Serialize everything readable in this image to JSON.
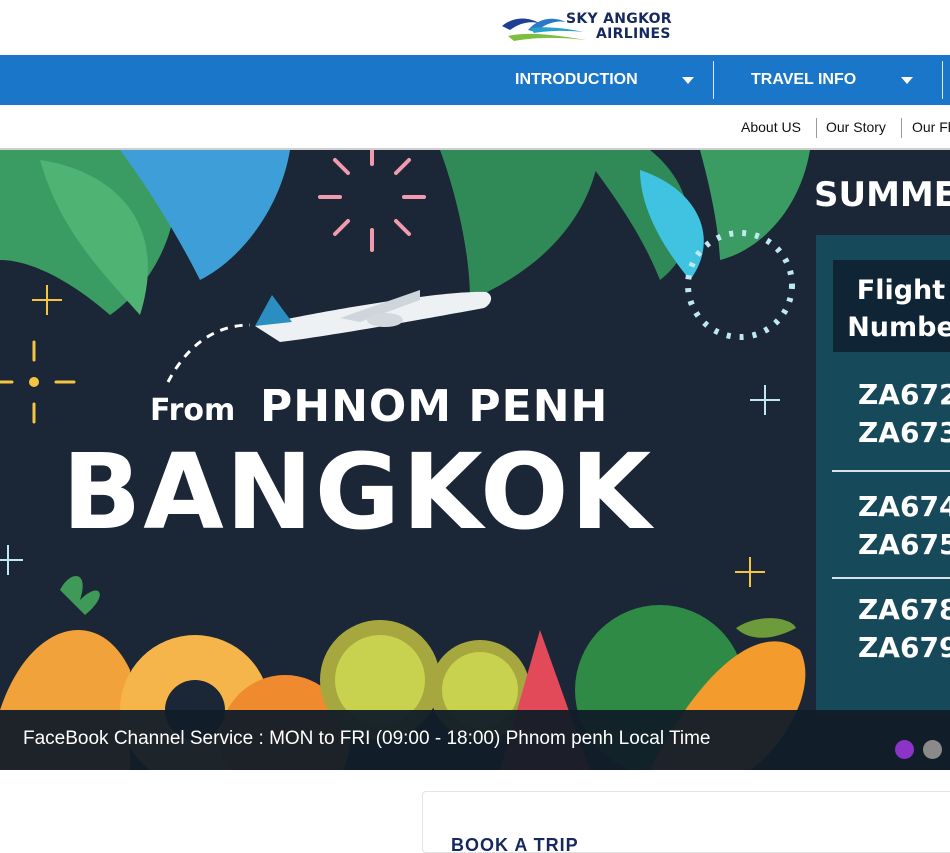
{
  "logo": {
    "line1": "SKY ANGKOR",
    "line2": "AIRLINES",
    "icon": "airline-logo-icon"
  },
  "nav": {
    "items": [
      {
        "label": "INTRODUCTION",
        "icon": "caret-down-icon"
      },
      {
        "label": "TRAVEL INFO",
        "icon": "caret-down-icon"
      }
    ]
  },
  "subnav": {
    "items": [
      "About US",
      "Our Story",
      "Our Fl"
    ]
  },
  "banner": {
    "season": "SUMME",
    "from": "From",
    "origin": "PHNOM PENH",
    "destination": "BANGKOK",
    "flight_header_1": "Flight",
    "flight_header_2": "Numbe",
    "flights": [
      "ZA672",
      "ZA673",
      "ZA674",
      "ZA675",
      "ZA678",
      "ZA679"
    ],
    "caption": "FaceBook Channel Service : MON to FRI (09:00 - 18:00) Phnom penh Local Time",
    "slides": {
      "count": 2,
      "active": 1
    }
  },
  "booking": {
    "title": "BOOK A TRIP"
  },
  "colors": {
    "nav": "#1976c8",
    "brand": "#16295e",
    "dot_active": "#8b34c7"
  }
}
